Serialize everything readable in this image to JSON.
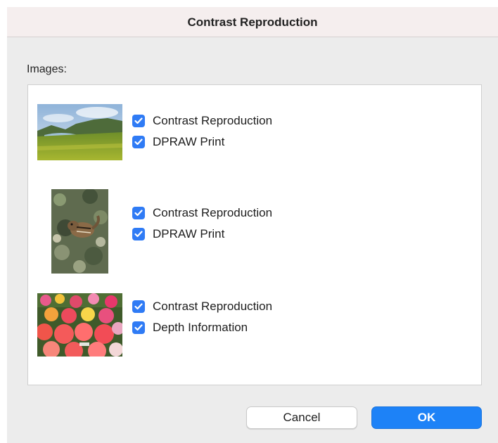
{
  "dialog": {
    "title": "Contrast Reproduction",
    "images_label": "Images:",
    "images": [
      {
        "thumbnail": "landscape-thumbnail",
        "options": [
          {
            "label": "Contrast Reproduction",
            "checked": true
          },
          {
            "label": "DPRAW Print",
            "checked": true
          }
        ]
      },
      {
        "thumbnail": "chipmunk-thumbnail",
        "options": [
          {
            "label": "Contrast Reproduction",
            "checked": true
          },
          {
            "label": "DPRAW Print",
            "checked": true
          }
        ]
      },
      {
        "thumbnail": "flowers-thumbnail",
        "options": [
          {
            "label": "Contrast Reproduction",
            "checked": true
          },
          {
            "label": "Depth Information",
            "checked": true
          }
        ]
      }
    ],
    "buttons": {
      "cancel": "Cancel",
      "ok": "OK"
    }
  },
  "colors": {
    "checkbox": "#2f7bf5",
    "ok_button": "#1d82f7",
    "dialog_background": "#ececec"
  }
}
